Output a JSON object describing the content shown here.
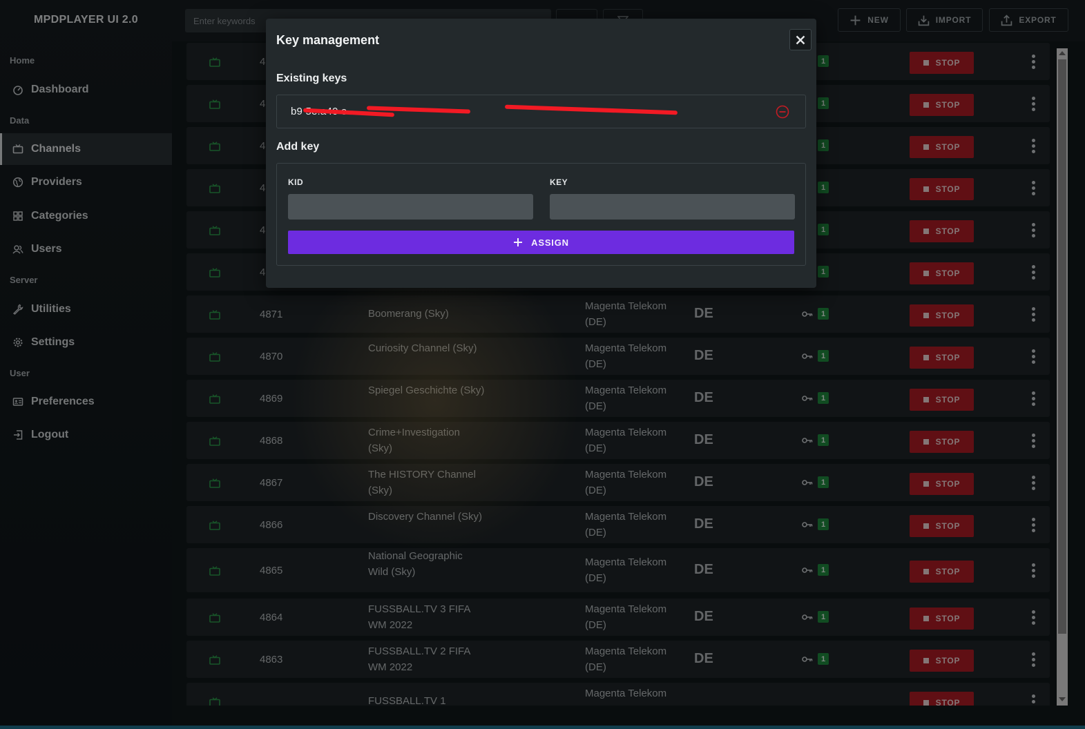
{
  "app": {
    "title": "MPDPLAYER UI 2.0"
  },
  "sidebar": {
    "sections": [
      {
        "label": "Home"
      },
      {
        "label": "Data"
      },
      {
        "label": "Server"
      },
      {
        "label": "User"
      }
    ],
    "items": [
      {
        "label": "Dashboard",
        "icon": "dashboard-icon"
      },
      {
        "label": "Channels",
        "icon": "tv-icon",
        "active": true
      },
      {
        "label": "Providers",
        "icon": "globe-icon"
      },
      {
        "label": "Categories",
        "icon": "grid-icon"
      },
      {
        "label": "Users",
        "icon": "users-icon"
      },
      {
        "label": "Utilities",
        "icon": "wrench-icon"
      },
      {
        "label": "Settings",
        "icon": "gear-icon"
      },
      {
        "label": "Preferences",
        "icon": "id-card-icon"
      },
      {
        "label": "Logout",
        "icon": "logout-icon"
      }
    ]
  },
  "header": {
    "search_placeholder": "Enter keywords",
    "new_label": "NEW",
    "import_label": "IMPORT",
    "export_label": "EXPORT"
  },
  "table": {
    "stop_label": "STOP",
    "rows": [
      {
        "id": "4",
        "name": "",
        "provider": "",
        "country": "",
        "keys": "1"
      },
      {
        "id": "4",
        "name": "",
        "provider": "",
        "country": "",
        "keys": "1"
      },
      {
        "id": "4",
        "name": "",
        "provider": "",
        "country": "",
        "keys": "1"
      },
      {
        "id": "4",
        "name": "",
        "provider": "",
        "country": "",
        "keys": "1"
      },
      {
        "id": "4",
        "name": "",
        "provider": "",
        "country": "",
        "keys": "1"
      },
      {
        "id": "4",
        "name": "",
        "provider": "",
        "country": "",
        "keys": "1"
      },
      {
        "id": "4871",
        "name": "Boomerang (Sky)",
        "provider": "Magenta Telekom (DE)",
        "country": "DE",
        "keys": "1"
      },
      {
        "id": "4870",
        "name": "Curiosity Channel (Sky)",
        "provider": "Magenta Telekom (DE)",
        "country": "DE",
        "keys": "1"
      },
      {
        "id": "4869",
        "name": "Spiegel Geschichte (Sky)",
        "provider": "Magenta Telekom (DE)",
        "country": "DE",
        "keys": "1"
      },
      {
        "id": "4868",
        "name": "Crime+Investigation (Sky)",
        "provider": "Magenta Telekom (DE)",
        "country": "DE",
        "keys": "1"
      },
      {
        "id": "4867",
        "name": "The HISTORY Channel (Sky)",
        "provider": "Magenta Telekom (DE)",
        "country": "DE",
        "keys": "1"
      },
      {
        "id": "4866",
        "name": "Discovery Channel (Sky)",
        "provider": "Magenta Telekom (DE)",
        "country": "DE",
        "keys": "1"
      },
      {
        "id": "4865",
        "name": "National Geographic Wild (Sky)",
        "provider": "Magenta Telekom (DE)",
        "country": "DE",
        "keys": "1"
      },
      {
        "id": "4864",
        "name": "FUSSBALL.TV 3 FIFA WM 2022",
        "provider": "Magenta Telekom (DE)",
        "country": "DE",
        "keys": "1"
      },
      {
        "id": "4863",
        "name": "FUSSBALL.TV 2 FIFA WM 2022",
        "provider": "Magenta Telekom (DE)",
        "country": "DE",
        "keys": "1"
      },
      {
        "id": "",
        "name": "FUSSBALL.TV 1",
        "provider": "Magenta Telekom",
        "country": "",
        "keys": ""
      }
    ]
  },
  "modal": {
    "title": "Key management",
    "existing_label": "Existing keys",
    "existing_key": "b9                                 5e:a40                                              e",
    "add_label": "Add key",
    "kid_label": "KID",
    "key_label": "KEY",
    "kid_value": "",
    "key_value": "",
    "assign_label": "ASSIGN"
  },
  "colors": {
    "stop": "#b01c26",
    "assign": "#6d2ce0",
    "badge": "#1f8a3e",
    "tv_icon": "#2d9c4c",
    "redaction": "#f21a24"
  }
}
